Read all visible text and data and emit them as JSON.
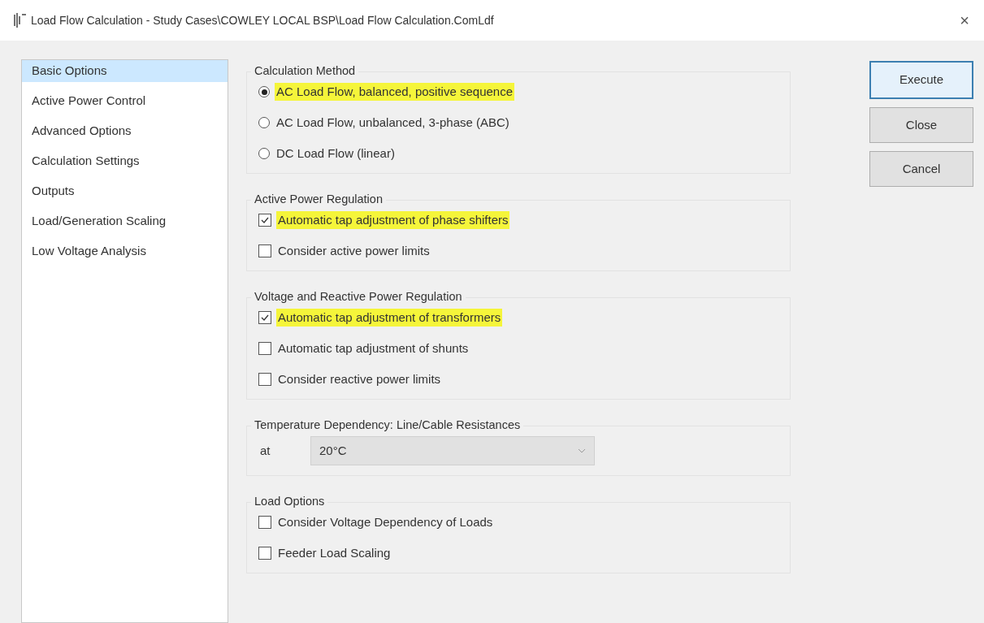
{
  "window": {
    "title": "Load Flow Calculation - Study Cases\\COWLEY LOCAL BSP\\Load Flow Calculation.ComLdf",
    "close": "×"
  },
  "sidebar": {
    "items": [
      {
        "label": "Basic Options",
        "selected": true
      },
      {
        "label": "Active Power Control",
        "selected": false
      },
      {
        "label": "Advanced Options",
        "selected": false
      },
      {
        "label": "Calculation Settings",
        "selected": false
      },
      {
        "label": "Outputs",
        "selected": false
      },
      {
        "label": "Load/Generation Scaling",
        "selected": false
      },
      {
        "label": "Low Voltage Analysis",
        "selected": false
      }
    ]
  },
  "groups": [
    {
      "title": "Calculation Method",
      "items": [
        {
          "kind": "radio",
          "label": "AC Load Flow, balanced, positive sequence",
          "selected": true,
          "highlighted": true
        },
        {
          "kind": "radio",
          "label": "AC Load Flow, unbalanced, 3-phase (ABC)",
          "selected": false,
          "highlighted": false
        },
        {
          "kind": "radio",
          "label": "DC Load Flow (linear)",
          "selected": false,
          "highlighted": false
        }
      ]
    },
    {
      "title": "Active Power Regulation",
      "items": [
        {
          "kind": "checkbox",
          "label": "Automatic tap adjustment of phase shifters",
          "checked": true,
          "highlighted": true
        },
        {
          "kind": "checkbox",
          "label": "Consider active power limits",
          "checked": false,
          "highlighted": false
        }
      ]
    },
    {
      "title": "Voltage and Reactive Power Regulation",
      "items": [
        {
          "kind": "checkbox",
          "label": "Automatic tap adjustment of transformers",
          "checked": true,
          "highlighted": true
        },
        {
          "kind": "checkbox",
          "label": "Automatic tap adjustment of shunts",
          "checked": false,
          "highlighted": false
        },
        {
          "kind": "checkbox",
          "label": "Consider reactive power limits",
          "checked": false,
          "highlighted": false
        }
      ]
    },
    {
      "title": "Temperature Dependency: Line/Cable Resistances",
      "items": [
        {
          "kind": "dropdown",
          "label": "at",
          "value": "20°C"
        }
      ]
    },
    {
      "title": "Load Options",
      "items": [
        {
          "kind": "checkbox",
          "label": "Consider Voltage Dependency of Loads",
          "checked": false,
          "highlighted": false
        },
        {
          "kind": "checkbox",
          "label": "Feeder Load Scaling",
          "checked": false,
          "highlighted": false
        }
      ]
    }
  ],
  "buttons": [
    {
      "label": "Execute",
      "default": true
    },
    {
      "label": "Close",
      "default": false
    },
    {
      "label": "Cancel",
      "default": false
    }
  ]
}
